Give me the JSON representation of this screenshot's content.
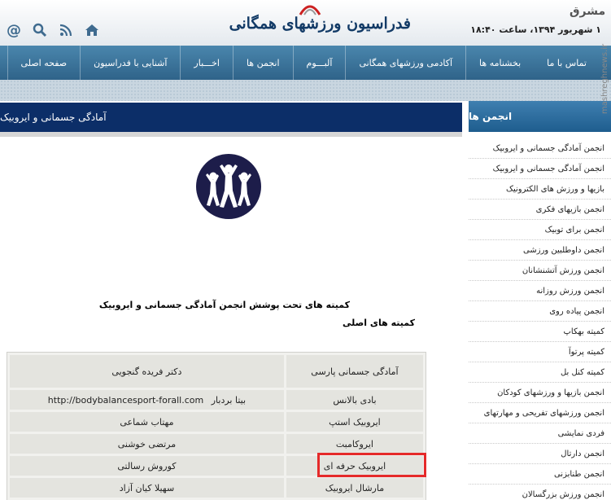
{
  "header": {
    "site_title": "فدراسیون ورزشهای همگانی",
    "date_text": "۱ شهریور ۱۳۹۴، ساعت ۱۸:۴۰",
    "watermark": "مشرق",
    "side_watermark": "mashreghnews.ir",
    "icons": [
      "at-icon",
      "search-icon",
      "rss-icon",
      "home-icon"
    ]
  },
  "nav": {
    "items": [
      "صفحه اصلی",
      "آشنایی با فدراسیون",
      "اخـــبار",
      "انجمن ها",
      "آلبـــوم",
      "آکادمی ورزشهای همگانی",
      "بخشنامه ها",
      "تماس با ما"
    ]
  },
  "main": {
    "title": "آمادگی جسمانی و ایروبیک",
    "heading": "کمیته های تحت پوشش انجمن آمادگی جسمانی و ایروبیک",
    "subheading": "کمیته های اصلی",
    "table": {
      "rows": [
        {
          "name": "آمادگی جسمانی پارسی",
          "person": "دکتر فریده گنجویی"
        },
        {
          "name": "بادی بالانس",
          "person": "بیتا بردبار",
          "url": "http://bodybalancesport-forall.com"
        },
        {
          "name": "ایروبیک استپ",
          "person": "مهتاب شماعی"
        },
        {
          "name": "ایروکامبت",
          "person": "مرتضی خوشنی"
        },
        {
          "name": "ایروبیک حرفه ای",
          "person": "کوروش رسالتی"
        },
        {
          "name": "مارشال ایروبیک",
          "person": "سهیلا کیان آزاد"
        }
      ]
    },
    "highlight_color": "#e52a2a"
  },
  "sidebar": {
    "title": "انجمن ها",
    "items": [
      "انجمن آمادگی جسمانی و ایروبیک",
      "انجمن آمادگی جسمانی و ایروبیک",
      "بازیها و ورزش های الکترونیک",
      "انجمن بازیهای فکری",
      "انجمن برای توبیک",
      "انجمن داوطلبین ورزشی",
      "انجمن ورزش آتشنشانان",
      "انجمن ورزش روزانه",
      "انجمن پیاده روی",
      "کمیته بهکاپ",
      "کمیته پرتوآ",
      "کمیته کنل بل",
      "انجمن بازیها و ورزشهای کودکان",
      "انجمن ورزشهای تفریحی و مهارتهای",
      "فردی نمایشی",
      "انجمن دارتال",
      "انجمن طنابزنی",
      "انجمن ورزش بزرگسالان"
    ]
  }
}
